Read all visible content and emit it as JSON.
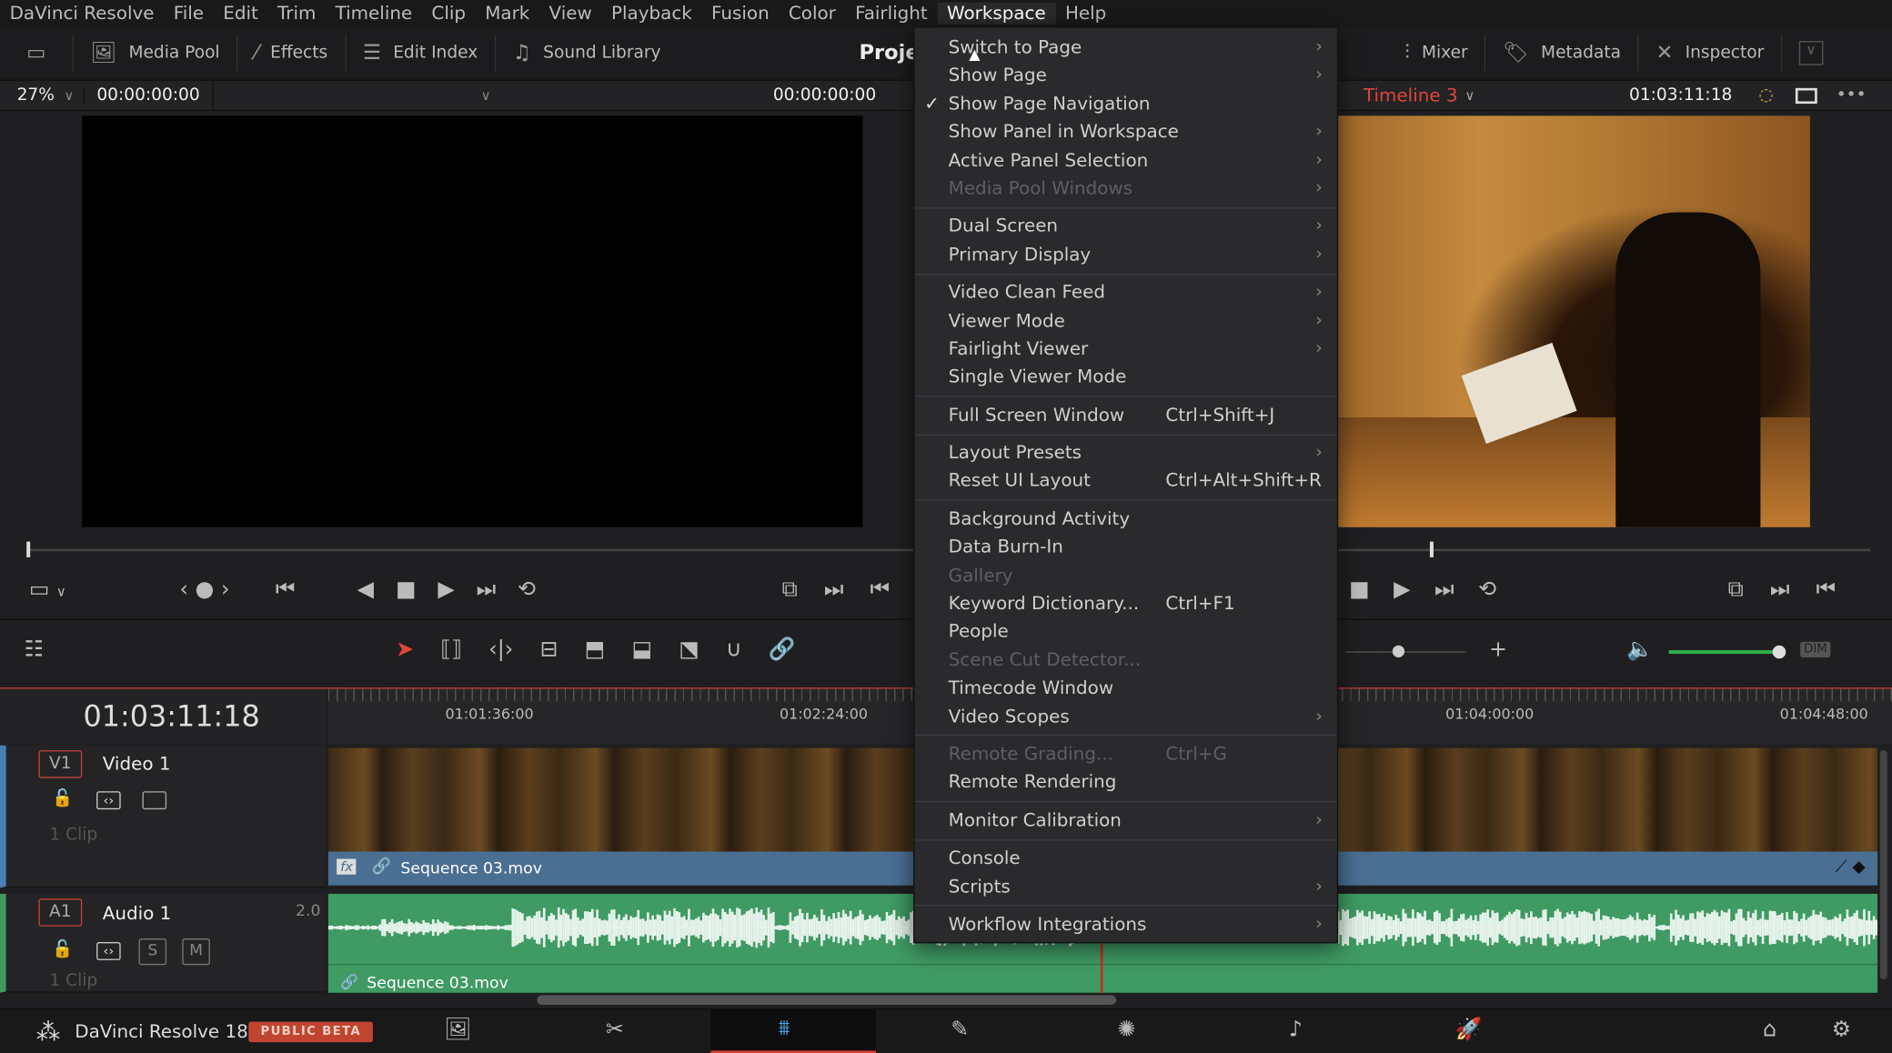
{
  "menubar": {
    "items": [
      "DaVinci Resolve",
      "File",
      "Edit",
      "Trim",
      "Timeline",
      "Clip",
      "Mark",
      "View",
      "Playback",
      "Fusion",
      "Color",
      "Fairlight",
      "Workspace",
      "Help"
    ],
    "active": "Workspace"
  },
  "toolbar": {
    "media_pool": "Media Pool",
    "effects": "Effects",
    "edit_index": "Edit Index",
    "sound_library": "Sound Library",
    "project_title": "Proje",
    "mixer": "Mixer",
    "metadata": "Metadata",
    "inspector": "Inspector"
  },
  "source_viewer": {
    "zoom": "27%",
    "timecode_left": "00:00:00:00",
    "timecode_right": "00:00:00:00"
  },
  "timeline_viewer": {
    "timeline_name": "Timeline 3",
    "timecode": "01:03:11:18",
    "accent": "#e0463c"
  },
  "timeline": {
    "current_timecode": "01:03:11:18",
    "ruler": [
      "01:01:36:00",
      "01:02:24:00",
      "01:04:00:00",
      "01:04:48:00"
    ],
    "tracks": [
      {
        "tag": "V1",
        "name": "Video 1",
        "clips": "1 Clip",
        "clip_name": "Sequence 03.mov",
        "fx": "fx",
        "color": "#4a6f93"
      },
      {
        "tag": "A1",
        "name": "Audio 1",
        "channels": "2.0",
        "clips": "1 Clip",
        "clip_name": "Sequence 03.mov",
        "solo": "S",
        "mute": "M",
        "color": "#3f9a63"
      }
    ],
    "dim": "DIM"
  },
  "workspace_menu": {
    "items": [
      {
        "label": "Switch to Page",
        "submenu": true
      },
      {
        "label": "Show Page",
        "submenu": true
      },
      {
        "label": "Show Page Navigation",
        "checked": true
      },
      {
        "label": "Show Panel in Workspace",
        "submenu": true
      },
      {
        "label": "Active Panel Selection",
        "submenu": true
      },
      {
        "label": "Media Pool Windows",
        "submenu": true,
        "disabled": true
      },
      {
        "separator": true
      },
      {
        "label": "Dual Screen",
        "submenu": true
      },
      {
        "label": "Primary Display",
        "submenu": true
      },
      {
        "separator": true
      },
      {
        "label": "Video Clean Feed",
        "submenu": true
      },
      {
        "label": "Viewer Mode",
        "submenu": true
      },
      {
        "label": "Fairlight Viewer",
        "submenu": true
      },
      {
        "label": "Single Viewer Mode"
      },
      {
        "separator": true
      },
      {
        "label": "Full Screen Window",
        "shortcut": "Ctrl+Shift+J"
      },
      {
        "separator": true
      },
      {
        "label": "Layout Presets",
        "submenu": true
      },
      {
        "label": "Reset UI Layout",
        "shortcut": "Ctrl+Alt+Shift+R"
      },
      {
        "separator": true
      },
      {
        "label": "Background Activity"
      },
      {
        "label": "Data Burn-In"
      },
      {
        "label": "Gallery",
        "disabled": true
      },
      {
        "label": "Keyword Dictionary...",
        "shortcut": "Ctrl+F1"
      },
      {
        "label": "People"
      },
      {
        "label": "Scene Cut Detector...",
        "disabled": true
      },
      {
        "label": "Timecode Window"
      },
      {
        "label": "Video Scopes",
        "submenu": true
      },
      {
        "separator": true
      },
      {
        "label": "Remote Grading...",
        "shortcut": "Ctrl+G",
        "disabled": true
      },
      {
        "label": "Remote Rendering"
      },
      {
        "separator": true
      },
      {
        "label": "Monitor Calibration",
        "submenu": true
      },
      {
        "separator": true
      },
      {
        "label": "Console"
      },
      {
        "label": "Scripts",
        "submenu": true
      },
      {
        "separator": true
      },
      {
        "label": "Workflow Integrations",
        "submenu": true
      }
    ]
  },
  "footer": {
    "app_name": "DaVinci Resolve 18",
    "badge": "PUBLIC BETA",
    "badge_color": "#c0452f",
    "pages": [
      "media",
      "cut",
      "edit",
      "fusion",
      "color",
      "fairlight",
      "deliver"
    ],
    "active_page": "edit"
  }
}
